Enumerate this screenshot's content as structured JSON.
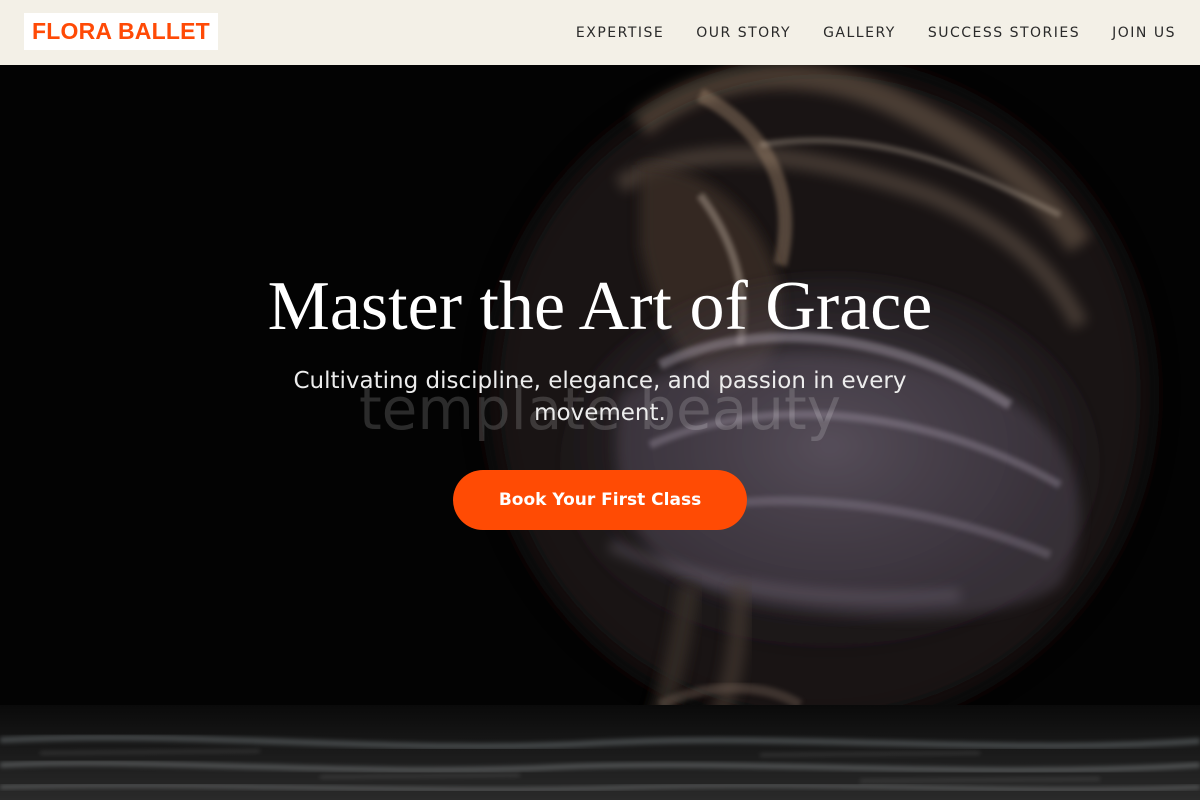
{
  "brand": {
    "name": "FLORA BALLET",
    "color": "#ff4a06"
  },
  "nav": {
    "items": [
      {
        "label": "EXPERTISE"
      },
      {
        "label": "OUR STORY"
      },
      {
        "label": "GALLERY"
      },
      {
        "label": "SUCCESS STORIES"
      },
      {
        "label": "JOIN US"
      }
    ]
  },
  "hero": {
    "background_image": "motion-blurred-dancer",
    "watermark": "template beauty",
    "title": "Master the Art of Grace",
    "subtitle": "Cultivating discipline, elegance, and passion in every movement.",
    "cta_label": "Book Your First Class",
    "cta_color": "#ff4b04"
  }
}
